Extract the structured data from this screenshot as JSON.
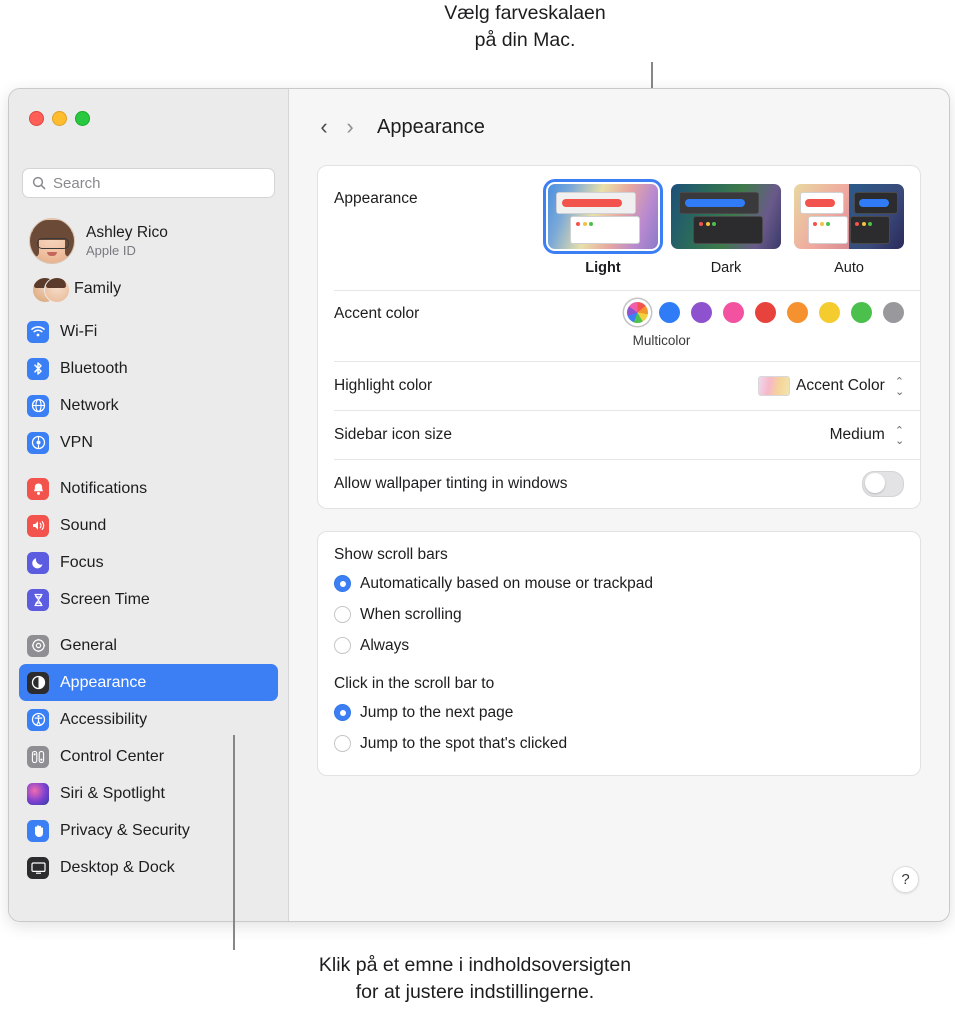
{
  "callouts": {
    "top": "Vælg farveskalaen\npå din Mac.",
    "bottom": "Klik på et emne i indholdsoversigten\nfor at justere indstillingerne."
  },
  "sidebar": {
    "search": {
      "placeholder": "Search",
      "value": ""
    },
    "account": {
      "name": "Ashley Rico",
      "subtitle": "Apple ID"
    },
    "family": {
      "label": "Family"
    },
    "groups": [
      {
        "items": [
          {
            "label": "Wi-Fi",
            "icon": "wifi-icon",
            "color": "#3b7ff5"
          },
          {
            "label": "Bluetooth",
            "icon": "bluetooth-icon",
            "color": "#3b7ff5"
          },
          {
            "label": "Network",
            "icon": "globe-icon",
            "color": "#3b7ff5"
          },
          {
            "label": "VPN",
            "icon": "vpn-icon",
            "color": "#3b7ff5"
          }
        ]
      },
      {
        "items": [
          {
            "label": "Notifications",
            "icon": "bell-icon",
            "color": "#f2534d"
          },
          {
            "label": "Sound",
            "icon": "speaker-icon",
            "color": "#f2534d"
          },
          {
            "label": "Focus",
            "icon": "moon-icon",
            "color": "#5b5ce0"
          },
          {
            "label": "Screen Time",
            "icon": "hourglass-icon",
            "color": "#5b5ce0"
          }
        ]
      },
      {
        "items": [
          {
            "label": "General",
            "icon": "gear-icon",
            "color": "#8e8e93"
          },
          {
            "label": "Appearance",
            "icon": "appearance-icon",
            "color": "#2c2c2e",
            "selected": true
          },
          {
            "label": "Accessibility",
            "icon": "accessibility-icon",
            "color": "#3b7ff5"
          },
          {
            "label": "Control Center",
            "icon": "control-center-icon",
            "color": "#8e8e93"
          },
          {
            "label": "Siri & Spotlight",
            "icon": "siri-icon",
            "color": "#6a4fd0"
          },
          {
            "label": "Privacy & Security",
            "icon": "hand-icon",
            "color": "#3b7ff5"
          },
          {
            "label": "Desktop & Dock",
            "icon": "desktop-icon",
            "color": "#2c2c2e"
          }
        ]
      }
    ]
  },
  "toolbar": {
    "back": "‹",
    "forward": "›",
    "title": "Appearance"
  },
  "main": {
    "appearance": {
      "label": "Appearance",
      "options": [
        {
          "label": "Light",
          "selected": true
        },
        {
          "label": "Dark",
          "selected": false
        },
        {
          "label": "Auto",
          "selected": false
        }
      ]
    },
    "accent_color": {
      "label": "Accent color",
      "caption": "Multicolor",
      "swatches": [
        {
          "name": "multicolor",
          "color": "multi",
          "selected": true
        },
        {
          "name": "blue",
          "color": "#2f7cf6"
        },
        {
          "name": "purple",
          "color": "#8f52cf"
        },
        {
          "name": "pink",
          "color": "#f252a0"
        },
        {
          "name": "red",
          "color": "#e8423c"
        },
        {
          "name": "orange",
          "color": "#f5912e"
        },
        {
          "name": "yellow",
          "color": "#f5cc2e"
        },
        {
          "name": "green",
          "color": "#4cc04c"
        },
        {
          "name": "graphite",
          "color": "#98989d"
        }
      ]
    },
    "highlight_color": {
      "label": "Highlight color",
      "value": "Accent Color"
    },
    "sidebar_icon_size": {
      "label": "Sidebar icon size",
      "value": "Medium"
    },
    "wallpaper_tinting": {
      "label": "Allow wallpaper tinting in windows",
      "on": false
    },
    "scroll_bars": {
      "title": "Show scroll bars",
      "options": [
        {
          "label": "Automatically based on mouse or trackpad",
          "selected": true
        },
        {
          "label": "When scrolling",
          "selected": false
        },
        {
          "label": "Always",
          "selected": false
        }
      ]
    },
    "click_scroll_bar": {
      "title": "Click in the scroll bar to",
      "options": [
        {
          "label": "Jump to the next page",
          "selected": true
        },
        {
          "label": "Jump to the spot that's clicked",
          "selected": false
        }
      ]
    },
    "help": "?"
  }
}
